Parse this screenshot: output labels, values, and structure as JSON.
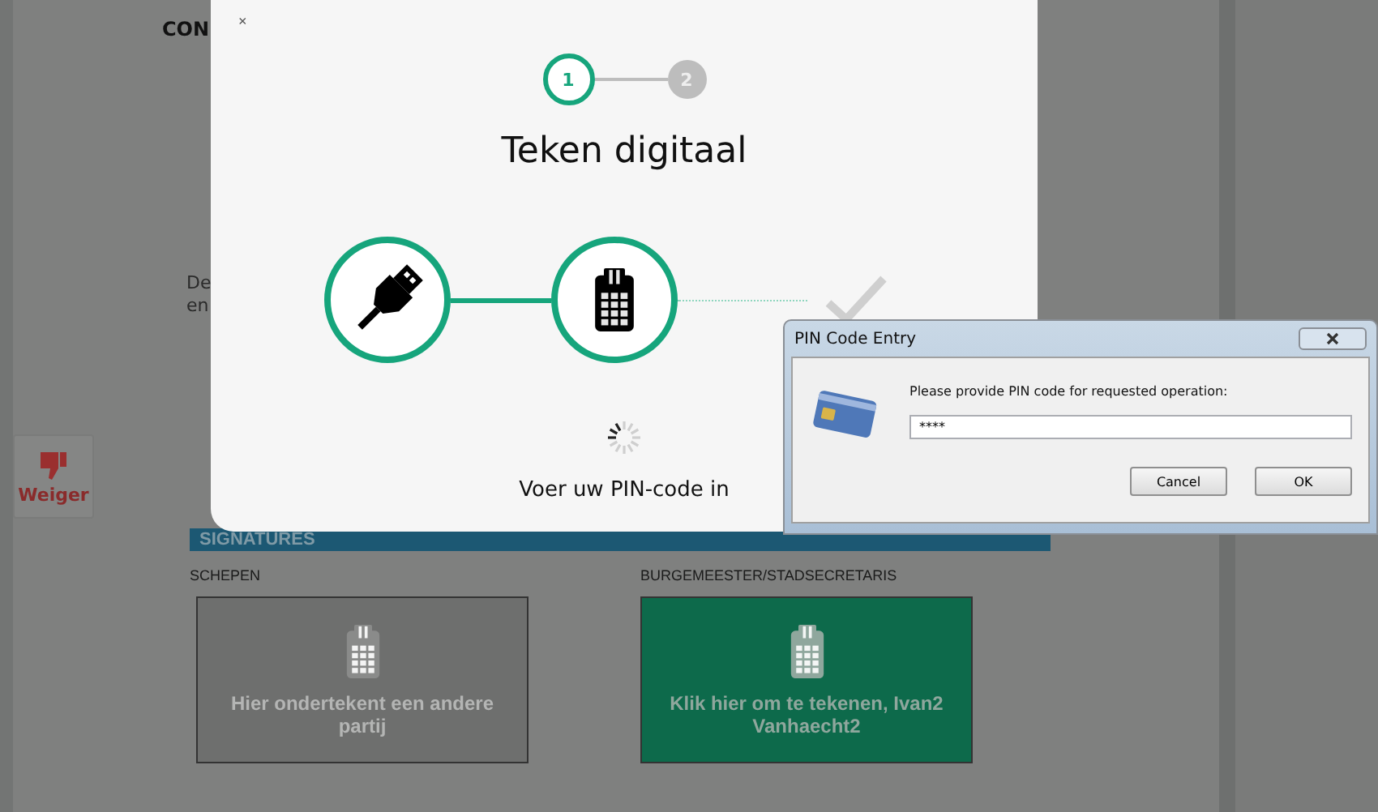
{
  "page": {
    "title": "CON",
    "intro_lines": [
      "De",
      "en"
    ],
    "reject_button": {
      "label": "Weiger"
    },
    "signatures_heading": "SIGNATURES",
    "signers": [
      {
        "role": "SCHEPEN",
        "text": "Hier ondertekent een andere partij",
        "kind": "other"
      },
      {
        "role": "BURGEMEESTER/STADSECRETARIS",
        "text": "Klik hier om te tekenen, Ivan2 Vanhaecht2",
        "kind": "own"
      }
    ]
  },
  "modal": {
    "close": "×",
    "title": "Teken digitaal",
    "status": "Voer uw PIN-code in",
    "steps": [
      {
        "label": "1",
        "selected": true
      },
      {
        "label": "2",
        "selected": false
      }
    ],
    "stages": [
      {
        "kind": "usb",
        "done": true
      },
      {
        "kind": "reader",
        "done": true
      },
      {
        "kind": "check",
        "done": false
      }
    ]
  },
  "pin_dialog": {
    "title": "PIN Code Entry",
    "prompt": "Please provide PIN code for requested operation:",
    "value": "****",
    "buttons": [
      "Cancel",
      "OK"
    ]
  }
}
